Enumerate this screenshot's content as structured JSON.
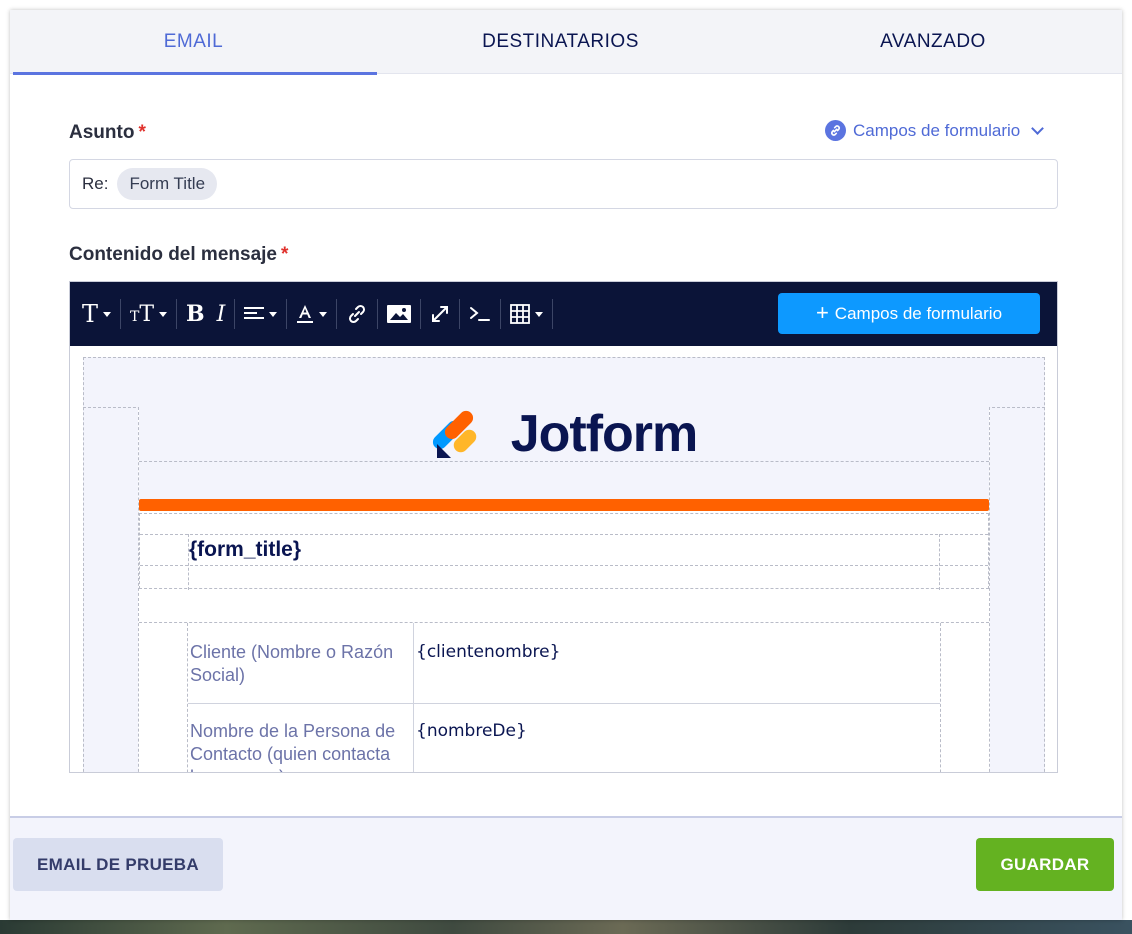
{
  "tabs": [
    {
      "label": "EMAIL",
      "active": true
    },
    {
      "label": "DESTINATARIOS",
      "active": false
    },
    {
      "label": "AVANZADO",
      "active": false
    }
  ],
  "subject": {
    "label": "Asunto",
    "required_mark": "*",
    "prefix": "Re:",
    "tag": "Form Title"
  },
  "fields_link": {
    "label": "Campos de formulario",
    "icon": "link-icon"
  },
  "content": {
    "label": "Contenido del mensaje",
    "required_mark": "*"
  },
  "toolbar": {
    "items": [
      "text-format-icon",
      "font-size-icon",
      "bold-icon",
      "italic-icon",
      "align-icon",
      "text-color-icon",
      "link-icon",
      "image-icon",
      "fullscreen-icon",
      "code-icon",
      "table-icon"
    ],
    "add_fields_label": "Campos de formulario"
  },
  "email_body": {
    "logo_text": "Jotform",
    "form_title": "{form_title}",
    "rows": [
      {
        "label": "Cliente (Nombre o Razón Social)",
        "value": "{clientenombre}"
      },
      {
        "label": "Nombre de la Persona de Contacto (quien contacta la empresa)",
        "value": "{nombreDe}"
      }
    ]
  },
  "footer": {
    "test_button": "EMAIL DE PRUEBA",
    "save_button": "GUARDAR"
  },
  "colors": {
    "accent": "#4f6ad6",
    "toolbar_bg": "#0b1438",
    "add_button": "#0d99ff",
    "brand_orange": "#ff6100",
    "save_green": "#64b221",
    "navy": "#0a1551"
  }
}
